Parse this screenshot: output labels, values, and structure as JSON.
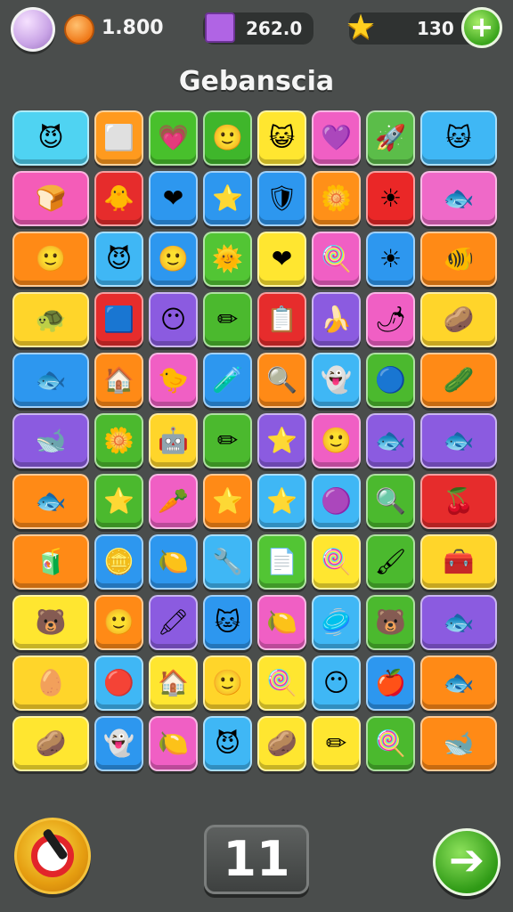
{
  "header": {
    "back_icon": "back-arrow-icon",
    "coin_value": "1.800",
    "gem_value": "262.0",
    "star_value": "130",
    "plus_label": "+"
  },
  "title": "Gebanscia",
  "board": {
    "rows": [
      [
        {
          "c": "#4fd3f2",
          "i": "😈"
        },
        {
          "c": "#ff9a1e",
          "i": "⬜"
        },
        {
          "c": "#48c02c",
          "i": "💗"
        },
        {
          "c": "#3fb62b",
          "i": "🙂"
        },
        {
          "c": "#ffe630",
          "i": "😺"
        },
        {
          "c": "#f05fc4",
          "i": "💜"
        },
        {
          "c": "#5bbd49",
          "i": "🚀"
        },
        {
          "c": "#3fb7f5",
          "i": "🐱"
        }
      ],
      [
        {
          "c": "#f45cb8",
          "i": "🍞"
        },
        {
          "c": "#e62c2c",
          "i": "🐥"
        },
        {
          "c": "#2d97ef",
          "i": "❤"
        },
        {
          "c": "#2d97ef",
          "i": "⭐"
        },
        {
          "c": "#2d97ef",
          "i": "🛡"
        },
        {
          "c": "#ff9018",
          "i": "🌼"
        },
        {
          "c": "#ea2727",
          "i": "☀"
        },
        {
          "c": "#ef69c8",
          "i": "🐟"
        }
      ],
      [
        {
          "c": "#ff8a16",
          "i": "🙂"
        },
        {
          "c": "#3fb7f5",
          "i": "😈"
        },
        {
          "c": "#2d97ef",
          "i": "🙂"
        },
        {
          "c": "#52c534",
          "i": "🌞"
        },
        {
          "c": "#ffe630",
          "i": "❤"
        },
        {
          "c": "#f05fc4",
          "i": "🍭"
        },
        {
          "c": "#2d97ef",
          "i": "☀"
        },
        {
          "c": "#ff8a16",
          "i": "🐠"
        }
      ],
      [
        {
          "c": "#ffd52a",
          "i": "🐢"
        },
        {
          "c": "#e62c2c",
          "i": "🟦"
        },
        {
          "c": "#8b5be0",
          "i": "😶"
        },
        {
          "c": "#4bb92e",
          "i": "✏"
        },
        {
          "c": "#e62c2c",
          "i": "📋"
        },
        {
          "c": "#8b5be0",
          "i": "🍌"
        },
        {
          "c": "#f05fc4",
          "i": "🌶"
        },
        {
          "c": "#ffd52a",
          "i": "🥔"
        }
      ],
      [
        {
          "c": "#2d97ef",
          "i": "🐟"
        },
        {
          "c": "#ff8a16",
          "i": "🏠"
        },
        {
          "c": "#f05fc4",
          "i": "🐤"
        },
        {
          "c": "#2d97ef",
          "i": "🧪"
        },
        {
          "c": "#ff8a16",
          "i": "🔍"
        },
        {
          "c": "#3fb7f5",
          "i": "👻"
        },
        {
          "c": "#4bb92e",
          "i": "🔵"
        },
        {
          "c": "#ff8a16",
          "i": "🥒"
        }
      ],
      [
        {
          "c": "#8b5be0",
          "i": "🐋"
        },
        {
          "c": "#4bb92e",
          "i": "🌼"
        },
        {
          "c": "#ffd52a",
          "i": "🤖"
        },
        {
          "c": "#4bb92e",
          "i": "✏"
        },
        {
          "c": "#8b5be0",
          "i": "⭐"
        },
        {
          "c": "#f05fc4",
          "i": "🙂"
        },
        {
          "c": "#8b5be0",
          "i": "🐟"
        },
        {
          "c": "#8b5be0",
          "i": "🐟"
        }
      ],
      [
        {
          "c": "#ff8a16",
          "i": "🐟"
        },
        {
          "c": "#4bb92e",
          "i": "⭐"
        },
        {
          "c": "#f05fc4",
          "i": "🥕"
        },
        {
          "c": "#ff8a16",
          "i": "⭐"
        },
        {
          "c": "#3fb7f5",
          "i": "⭐"
        },
        {
          "c": "#3fb7f5",
          "i": "🟣"
        },
        {
          "c": "#4bb92e",
          "i": "🔍"
        },
        {
          "c": "#e62c2c",
          "i": "🍒"
        }
      ],
      [
        {
          "c": "#ff8a16",
          "i": "🧃"
        },
        {
          "c": "#2d97ef",
          "i": "🪙"
        },
        {
          "c": "#2d97ef",
          "i": "🍋"
        },
        {
          "c": "#3fb7f5",
          "i": "🔧"
        },
        {
          "c": "#52c534",
          "i": "📄"
        },
        {
          "c": "#ffe630",
          "i": "🍭"
        },
        {
          "c": "#4bb92e",
          "i": "🖌"
        },
        {
          "c": "#ffd52a",
          "i": "🧰"
        }
      ],
      [
        {
          "c": "#ffe630",
          "i": "🐻"
        },
        {
          "c": "#ff8a16",
          "i": "🙂"
        },
        {
          "c": "#8b5be0",
          "i": "🖍"
        },
        {
          "c": "#2d97ef",
          "i": "🐱"
        },
        {
          "c": "#f05fc4",
          "i": "🍋"
        },
        {
          "c": "#3fb7f5",
          "i": "🥏"
        },
        {
          "c": "#4bb92e",
          "i": "🐻"
        },
        {
          "c": "#8b5be0",
          "i": "🐟"
        }
      ],
      [
        {
          "c": "#ffd52a",
          "i": "🥚"
        },
        {
          "c": "#3fb7f5",
          "i": "🔴"
        },
        {
          "c": "#ffe630",
          "i": "🏠"
        },
        {
          "c": "#ffd52a",
          "i": "🙂"
        },
        {
          "c": "#ffe630",
          "i": "🍭"
        },
        {
          "c": "#3fb7f5",
          "i": "😶"
        },
        {
          "c": "#2d97ef",
          "i": "🍎"
        },
        {
          "c": "#ff8a16",
          "i": "🐟"
        }
      ],
      [
        {
          "c": "#ffe630",
          "i": "🥔"
        },
        {
          "c": "#2d97ef",
          "i": "👻"
        },
        {
          "c": "#f05fc4",
          "i": "🍋"
        },
        {
          "c": "#3fb7f5",
          "i": "😈"
        },
        {
          "c": "#ffe630",
          "i": "🥔"
        },
        {
          "c": "#ffe630",
          "i": "✏"
        },
        {
          "c": "#4bb92e",
          "i": "🍭"
        },
        {
          "c": "#ff8a16",
          "i": "🐋"
        }
      ]
    ]
  },
  "footer": {
    "counter": "11",
    "next_label": "➔"
  }
}
